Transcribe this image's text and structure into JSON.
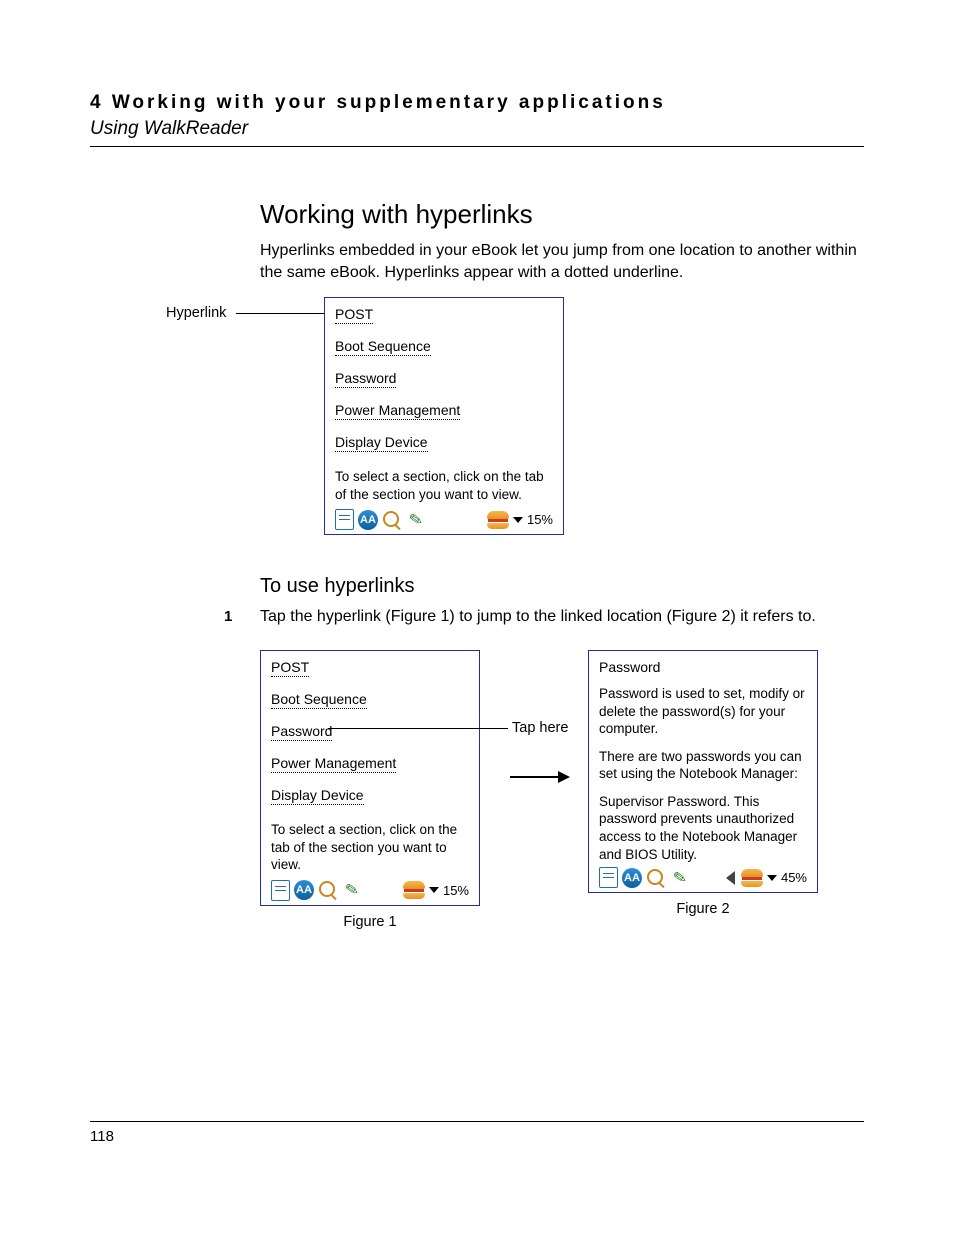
{
  "header": {
    "chapter": "4 Working with your supplementary applications",
    "section": "Using WalkReader"
  },
  "title": "Working with hyperlinks",
  "intro": "Hyperlinks embedded in your eBook let you jump from one location to another within the same eBook. Hyperlinks appear with a dotted underline.",
  "callouts": {
    "hyperlink": "Hyperlink",
    "tap_here": "Tap here"
  },
  "screenshot_main": {
    "links": [
      "POST",
      "Boot Sequence",
      "Password",
      "Power Management",
      "Display Device"
    ],
    "instruction": "To select a section, click on the tab of the section you want to view.",
    "toolbar": {
      "aa": "AA",
      "percent": "15%"
    }
  },
  "subhead": "To use hyperlinks",
  "step": {
    "num": "1",
    "text": "Tap the hyperlink (Figure 1) to jump to the linked location (Figure 2) it refers to."
  },
  "figure1": {
    "links": [
      "POST",
      "Boot Sequence",
      "Password",
      "Power Management",
      "Display Device"
    ],
    "instruction": "To select a section, click on the tab of the section you want to view.",
    "toolbar": {
      "aa": "AA",
      "percent": "15%"
    },
    "caption": "Figure 1"
  },
  "figure2": {
    "title": "Password",
    "para1": "Password is used to set, modify or delete the password(s) for your computer.",
    "para2": "There are two passwords you can set using the Notebook Manager:",
    "para3": "Supervisor Password. This password prevents unauthorized access to the Notebook Manager and BIOS Utility.",
    "toolbar": {
      "aa": "AA",
      "percent": "45%"
    },
    "caption": "Figure 2"
  },
  "page_number": "118"
}
